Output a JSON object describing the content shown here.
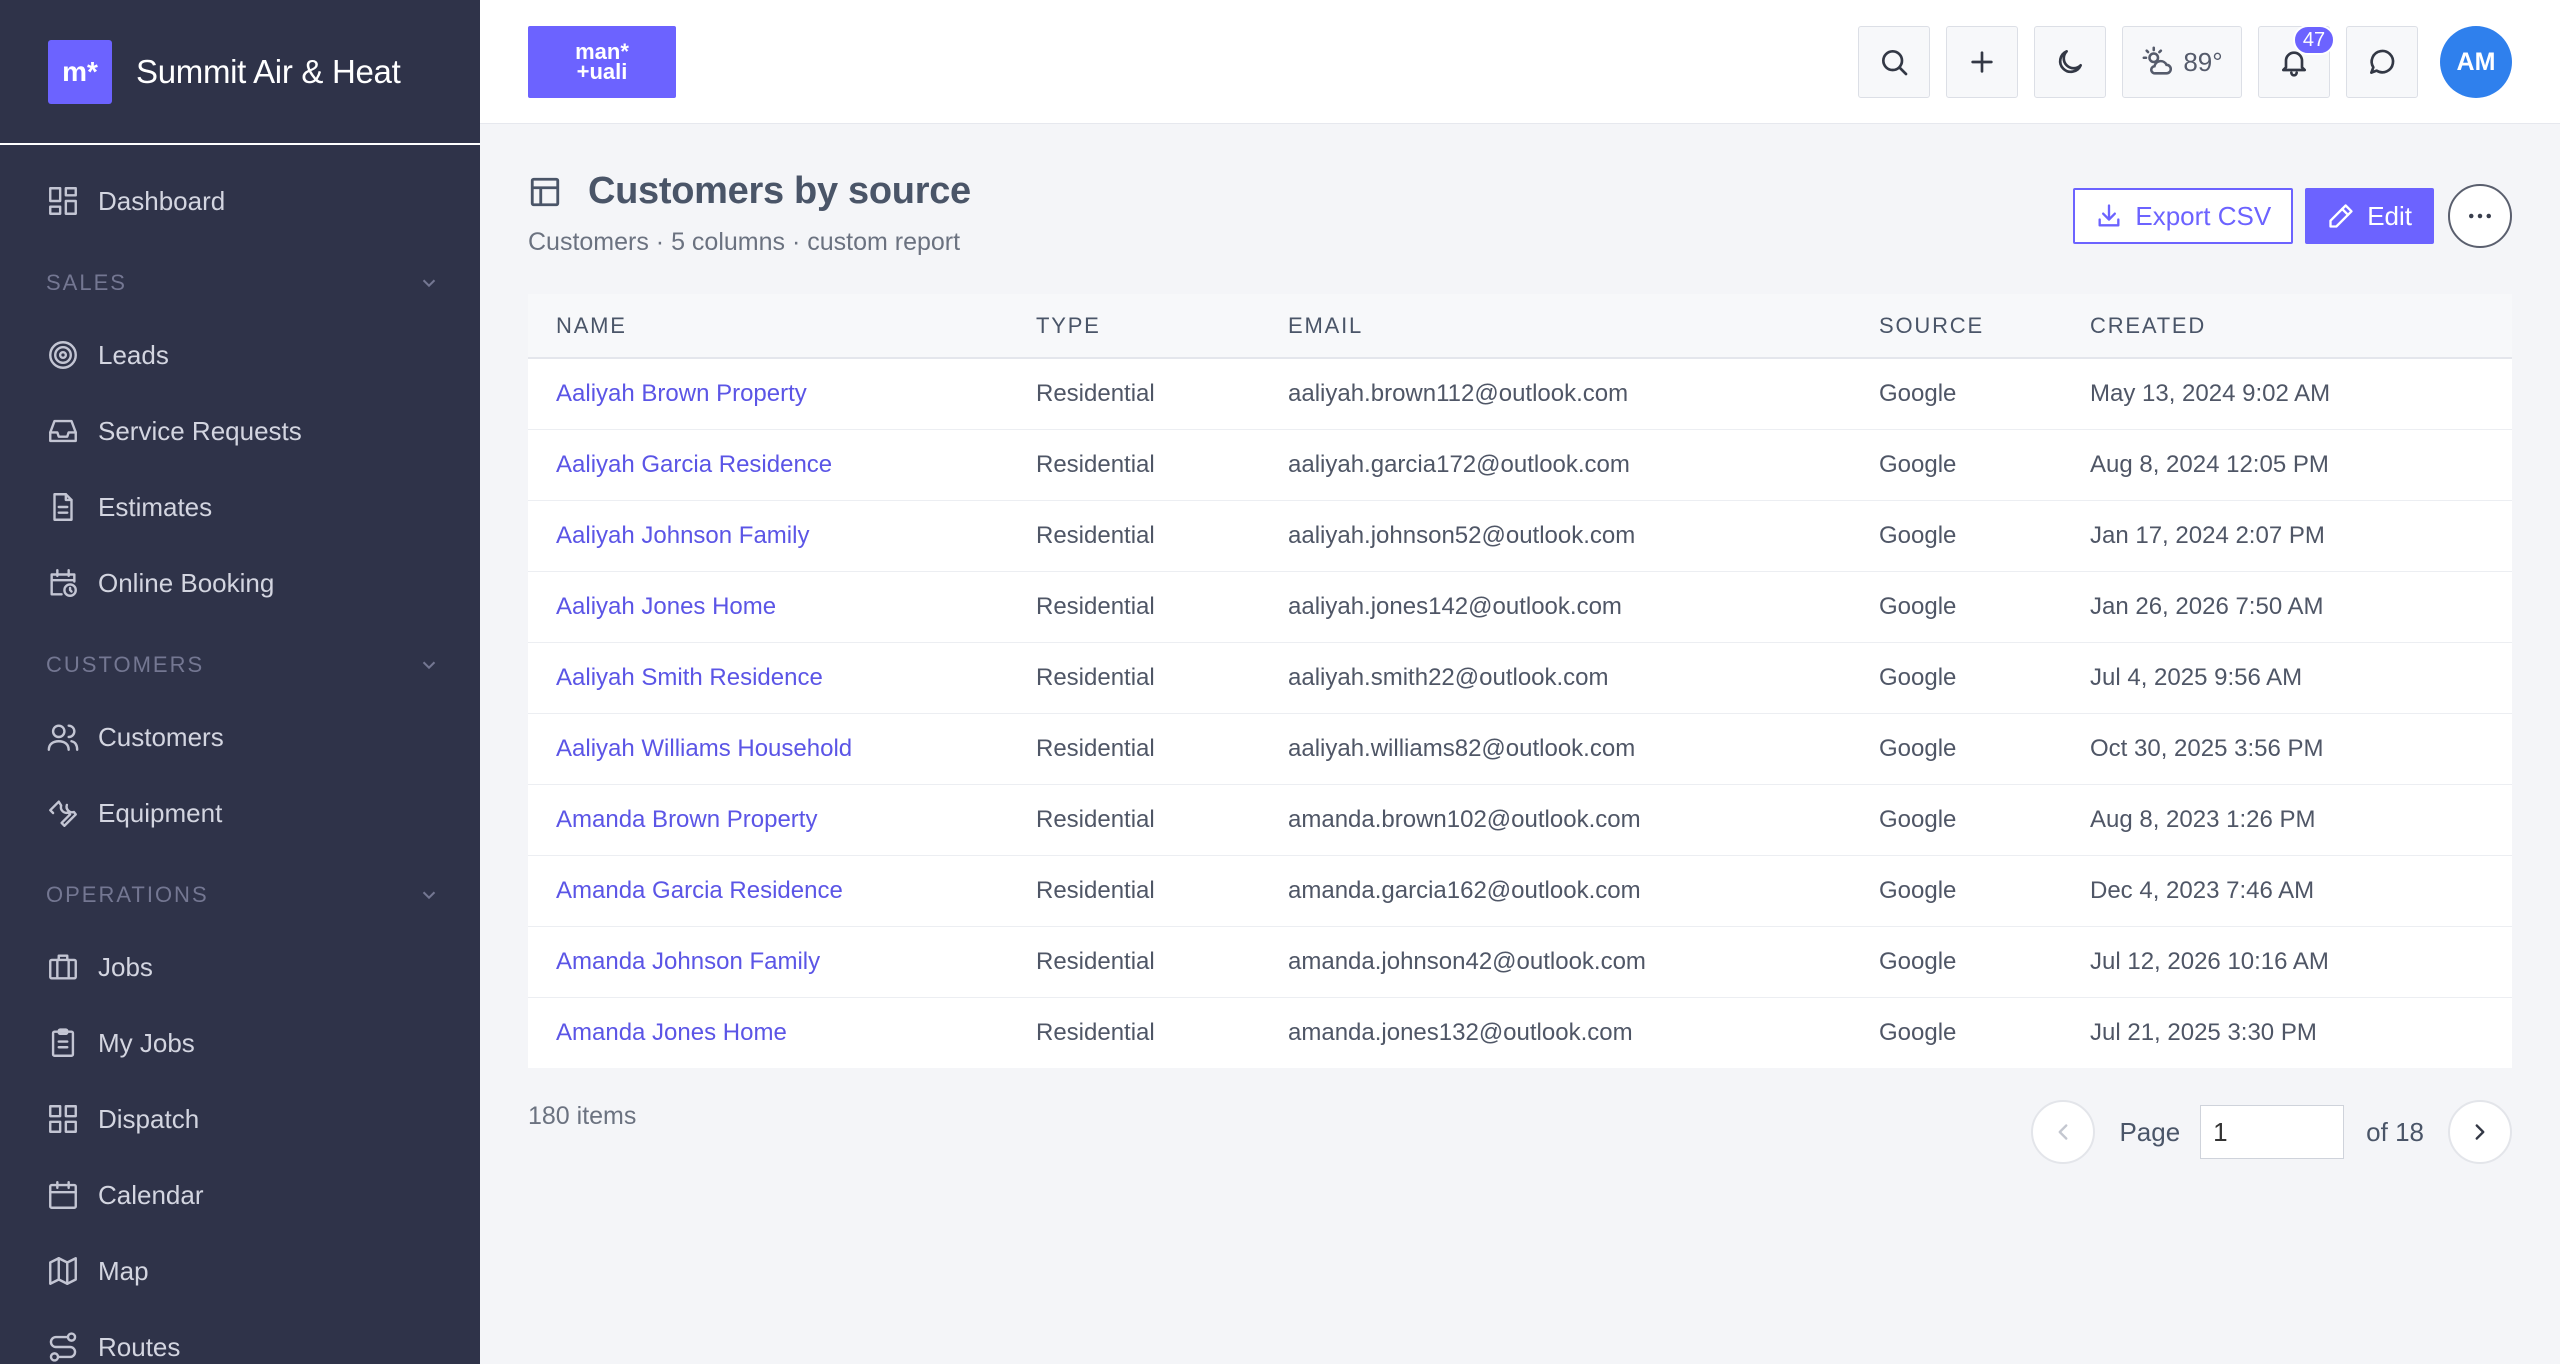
{
  "app": {
    "brand_logo_text": "m*",
    "brand_name": "Summit Air & Heat",
    "top_logo_line1": "man*",
    "top_logo_line2": "+uali"
  },
  "sidebar": {
    "dashboard": "Dashboard",
    "sections": {
      "sales": "SALES",
      "customers": "CUSTOMERS",
      "operations": "OPERATIONS"
    },
    "sales_items": [
      "Leads",
      "Service Requests",
      "Estimates",
      "Online Booking"
    ],
    "customer_items": [
      "Customers",
      "Equipment"
    ],
    "operations_items": [
      "Jobs",
      "My Jobs",
      "Dispatch",
      "Calendar",
      "Map",
      "Routes"
    ]
  },
  "topbar": {
    "weather_temp": "89°",
    "notification_count": "47",
    "avatar_initials": "AM"
  },
  "page": {
    "title": "Customers by source",
    "subtitle": "Customers · 5 columns · custom report",
    "export_label": "Export CSV",
    "edit_label": "Edit"
  },
  "table": {
    "headers": [
      "NAME",
      "TYPE",
      "EMAIL",
      "SOURCE",
      "CREATED"
    ],
    "rows": [
      {
        "name": "Aaliyah Brown Property",
        "type": "Residential",
        "email": "aaliyah.brown112@outlook.com",
        "source": "Google",
        "created": "May 13, 2024 9:02 AM"
      },
      {
        "name": "Aaliyah Garcia Residence",
        "type": "Residential",
        "email": "aaliyah.garcia172@outlook.com",
        "source": "Google",
        "created": "Aug 8, 2024 12:05 PM"
      },
      {
        "name": "Aaliyah Johnson Family",
        "type": "Residential",
        "email": "aaliyah.johnson52@outlook.com",
        "source": "Google",
        "created": "Jan 17, 2024 2:07 PM"
      },
      {
        "name": "Aaliyah Jones Home",
        "type": "Residential",
        "email": "aaliyah.jones142@outlook.com",
        "source": "Google",
        "created": "Jan 26, 2026 7:50 AM"
      },
      {
        "name": "Aaliyah Smith Residence",
        "type": "Residential",
        "email": "aaliyah.smith22@outlook.com",
        "source": "Google",
        "created": "Jul 4, 2025 9:56 AM"
      },
      {
        "name": "Aaliyah Williams Household",
        "type": "Residential",
        "email": "aaliyah.williams82@outlook.com",
        "source": "Google",
        "created": "Oct 30, 2025 3:56 PM"
      },
      {
        "name": "Amanda Brown Property",
        "type": "Residential",
        "email": "amanda.brown102@outlook.com",
        "source": "Google",
        "created": "Aug 8, 2023 1:26 PM"
      },
      {
        "name": "Amanda Garcia Residence",
        "type": "Residential",
        "email": "amanda.garcia162@outlook.com",
        "source": "Google",
        "created": "Dec 4, 2023 7:46 AM"
      },
      {
        "name": "Amanda Johnson Family",
        "type": "Residential",
        "email": "amanda.johnson42@outlook.com",
        "source": "Google",
        "created": "Jul 12, 2026 10:16 AM"
      },
      {
        "name": "Amanda Jones Home",
        "type": "Residential",
        "email": "amanda.jones132@outlook.com",
        "source": "Google",
        "created": "Jul 21, 2025 3:30 PM"
      }
    ]
  },
  "footer": {
    "items_count": "180 items",
    "page_label": "Page",
    "current_page": "1",
    "of_label": "of 18"
  }
}
